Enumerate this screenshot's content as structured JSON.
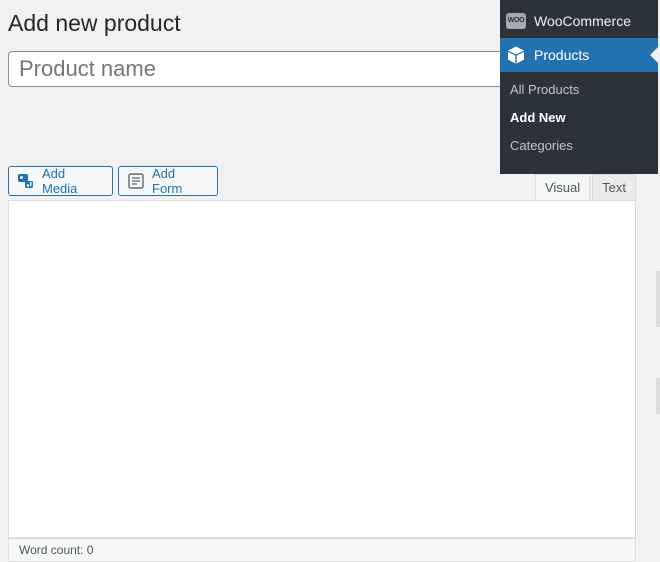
{
  "page": {
    "title": "Add new product"
  },
  "title_field": {
    "placeholder": "Product name",
    "value": ""
  },
  "media_buttons": {
    "add_media": "Add Media",
    "add_form": "Add Form"
  },
  "editor": {
    "tabs": [
      "Visual",
      "Text"
    ],
    "active_tab": "Visual",
    "word_count": "Word count: 0"
  },
  "admin_menu": {
    "parent": {
      "label": "WooCommerce",
      "icon": "woocommerce-icon",
      "icon_text": "WOO"
    },
    "current": {
      "label": "Products",
      "icon": "cube-icon"
    },
    "submenu": [
      {
        "label": "All Products"
      },
      {
        "label": "Add New",
        "current": true
      },
      {
        "label": "Categories"
      }
    ]
  },
  "colors": {
    "accent": "#2271b1",
    "menu_bg": "#2c3338",
    "page_bg": "#f1f1f1"
  }
}
